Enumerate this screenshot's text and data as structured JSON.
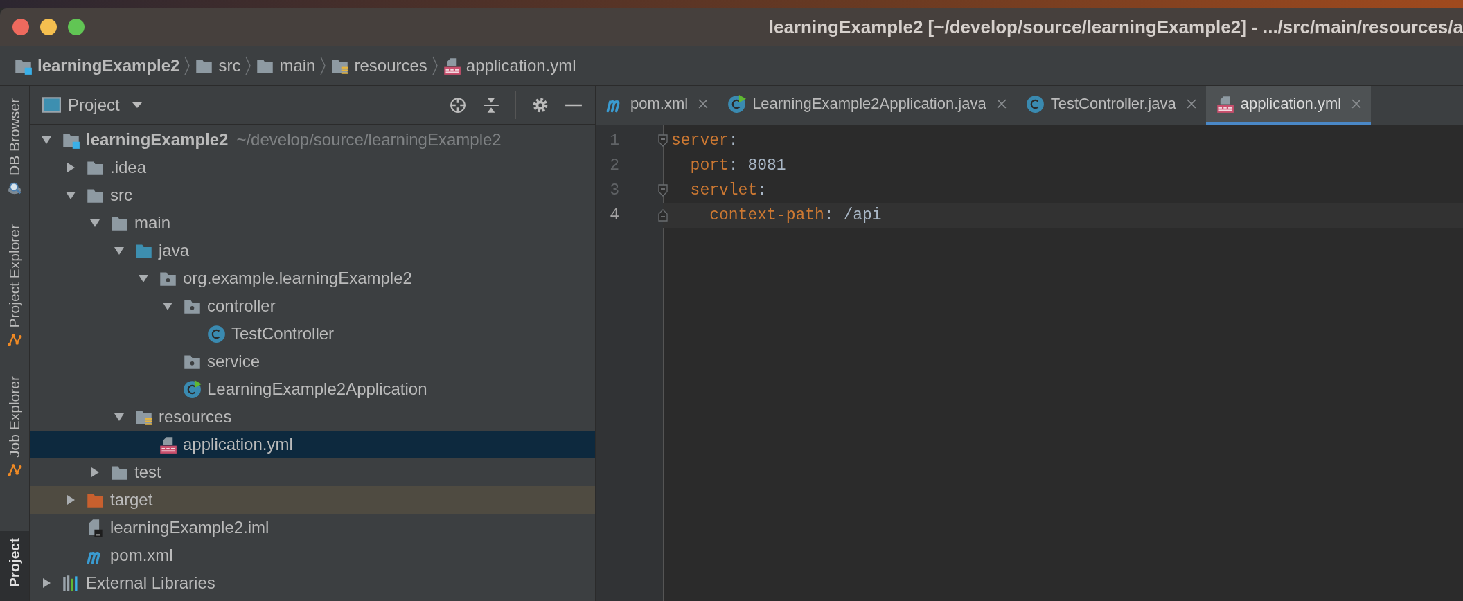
{
  "window": {
    "title": "learningExample2 [~/develop/source/learningExample2] - .../src/main/resources/a"
  },
  "breadcrumbs": [
    {
      "label": "learningExample2",
      "kind": "module"
    },
    {
      "label": "src",
      "kind": "folder"
    },
    {
      "label": "main",
      "kind": "folder"
    },
    {
      "label": "resources",
      "kind": "resources"
    },
    {
      "label": "application.yml",
      "kind": "yml"
    }
  ],
  "tool_windows": [
    {
      "label": "DB Browser",
      "kind": "db",
      "selected": false
    },
    {
      "label": "Project Explorer",
      "kind": "explorer",
      "selected": false
    },
    {
      "label": "Job Explorer",
      "kind": "explorer",
      "selected": false
    },
    {
      "label": "Project",
      "kind": "plain",
      "selected": true
    }
  ],
  "project_panel": {
    "title": "Project"
  },
  "tree": {
    "items": [
      {
        "label": "learningExample2",
        "kind": "module",
        "path": "~/develop/source/learningExample2",
        "expanded": true,
        "selected": false,
        "children": [
          {
            "label": ".idea",
            "kind": "folder",
            "expanded": false,
            "selected": false
          },
          {
            "label": "src",
            "kind": "folder",
            "expanded": true,
            "selected": false,
            "children": [
              {
                "label": "main",
                "kind": "folder",
                "expanded": true,
                "selected": false,
                "children": [
                  {
                    "label": "java",
                    "kind": "source-root",
                    "expanded": true,
                    "selected": false,
                    "children": [
                      {
                        "label": "org.example.learningExample2",
                        "kind": "package",
                        "expanded": true,
                        "selected": false,
                        "children": [
                          {
                            "label": "controller",
                            "kind": "package",
                            "expanded": true,
                            "selected": false,
                            "children": [
                              {
                                "label": "TestController",
                                "kind": "class",
                                "selected": false
                              }
                            ]
                          },
                          {
                            "label": "service",
                            "kind": "package",
                            "selected": false
                          },
                          {
                            "label": "LearningExample2Application",
                            "kind": "spring-class",
                            "selected": false
                          }
                        ]
                      }
                    ]
                  },
                  {
                    "label": "resources",
                    "kind": "resources",
                    "expanded": true,
                    "selected": false,
                    "children": [
                      {
                        "label": "application.yml",
                        "kind": "yml",
                        "selected": true
                      }
                    ]
                  }
                ]
              },
              {
                "label": "test",
                "kind": "folder",
                "expanded": false,
                "selected": false
              }
            ]
          },
          {
            "label": "target",
            "kind": "excluded",
            "expanded": false,
            "selected": false
          },
          {
            "label": "learningExample2.iml",
            "kind": "iml",
            "selected": false
          },
          {
            "label": "pom.xml",
            "kind": "maven",
            "selected": false
          }
        ]
      },
      {
        "label": "External Libraries",
        "kind": "libraries",
        "expanded": false,
        "selected": false
      }
    ]
  },
  "editor": {
    "tabs": [
      {
        "label": "pom.xml",
        "kind": "maven",
        "selected": false
      },
      {
        "label": "LearningExample2Application.java",
        "kind": "spring-class",
        "selected": false
      },
      {
        "label": "TestController.java",
        "kind": "class",
        "selected": false
      },
      {
        "label": "application.yml",
        "kind": "yml",
        "selected": true
      }
    ],
    "lines": [
      {
        "number": "1",
        "key": "server",
        "separator": ":",
        "fold_start": true,
        "fold_end": false,
        "current": false
      },
      {
        "number": "2",
        "key": "  port",
        "separator": ":",
        "value": " 8081",
        "fold_start": false,
        "fold_end": false,
        "current": false
      },
      {
        "number": "3",
        "key": "  servlet",
        "separator": ":",
        "fold_start": true,
        "fold_end": false,
        "current": false
      },
      {
        "number": "4",
        "key": "    context-path",
        "separator": ":",
        "value": " /api",
        "fold_start": false,
        "fold_end": true,
        "current": true
      }
    ]
  }
}
